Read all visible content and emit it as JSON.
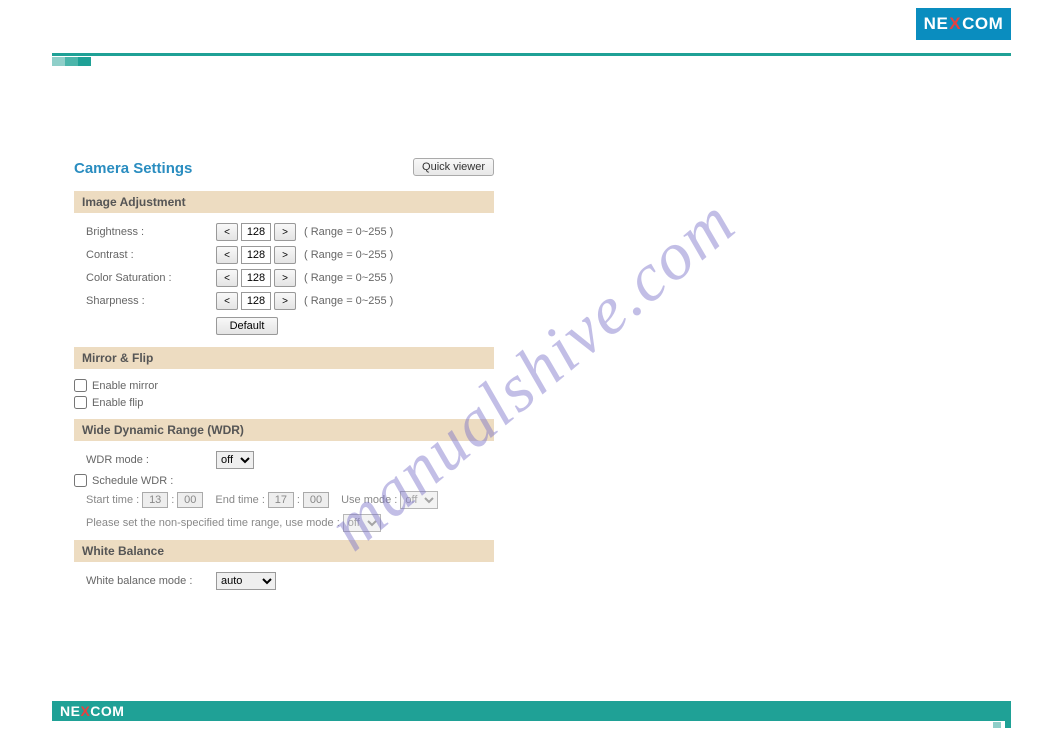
{
  "brand": {
    "part1": "NE",
    "x": "X",
    "part2": "COM"
  },
  "watermark": "manualshive.com",
  "page": {
    "title": "Camera Settings",
    "quickViewer": "Quick viewer"
  },
  "sections": {
    "imageAdjustment": {
      "title": "Image Adjustment",
      "brightness": {
        "label": "Brightness :",
        "value": "128",
        "range": "( Range = 0~255 )"
      },
      "contrast": {
        "label": "Contrast :",
        "value": "128",
        "range": "( Range = 0~255 )"
      },
      "saturation": {
        "label": "Color Saturation :",
        "value": "128",
        "range": "( Range = 0~255 )"
      },
      "sharpness": {
        "label": "Sharpness :",
        "value": "128",
        "range": "( Range = 0~255 )"
      },
      "defaultBtn": "Default",
      "decBtn": "<",
      "incBtn": ">"
    },
    "mirrorFlip": {
      "title": "Mirror & Flip",
      "enableMirror": "Enable mirror",
      "enableFlip": "Enable flip"
    },
    "wdr": {
      "title": "Wide Dynamic Range (WDR)",
      "modeLabel": "WDR mode :",
      "modeValue": "off",
      "scheduleLabel": "Schedule WDR :",
      "startTimeLabel": "Start time :",
      "startH": "13",
      "startM": "00",
      "endTimeLabel": "End time :",
      "endH": "17",
      "endM": "00",
      "useModeLabel": "Use mode :",
      "useModeValue": "off",
      "nonSpecLabel": "Please set the non-specified time range, use mode :",
      "nonSpecValue": "off",
      "colon": ":"
    },
    "whiteBalance": {
      "title": "White Balance",
      "modeLabel": "White balance mode :",
      "modeValue": "auto"
    }
  }
}
